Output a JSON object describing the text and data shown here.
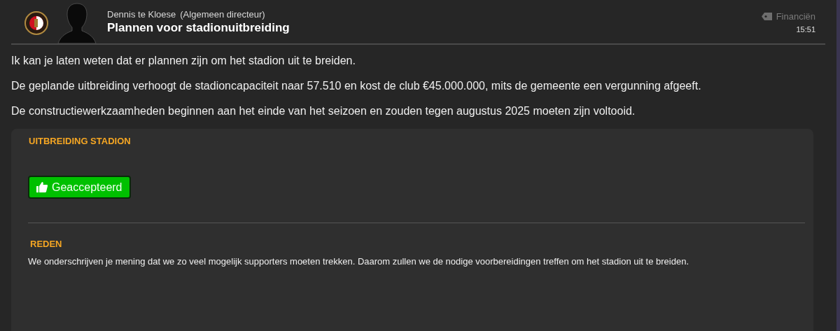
{
  "message": {
    "sender": "Dennis te Kloese",
    "role": "(Algemeen directeur)",
    "subject": "Plannen voor stadionuitbreiding",
    "category": "Financiën",
    "time": "15:51"
  },
  "paragraphs": [
    "Ik kan je laten weten dat er plannen zijn om het stadion uit te breiden.",
    "De geplande uitbreiding verhoogt de stadioncapaciteit naar 57.510 en kost de club €45.000.000, mits de gemeente een vergunning afgeeft.",
    "De constructiewerkzaamheden beginnen aan het einde van het seizoen en zouden tegen augustus 2025 moeten zijn voltooid."
  ],
  "decision": {
    "title": "UITBREIDING STADION",
    "status": {
      "label": "Geaccepteerd",
      "kind": "accepted"
    },
    "reason_title": "REDEN",
    "reason": "We onderschrijven je mening dat we zo veel mogelijk supporters moeten trekken. Daarom zullen we de nodige voorbereidingen treffen om het stadion uit te breiden."
  }
}
